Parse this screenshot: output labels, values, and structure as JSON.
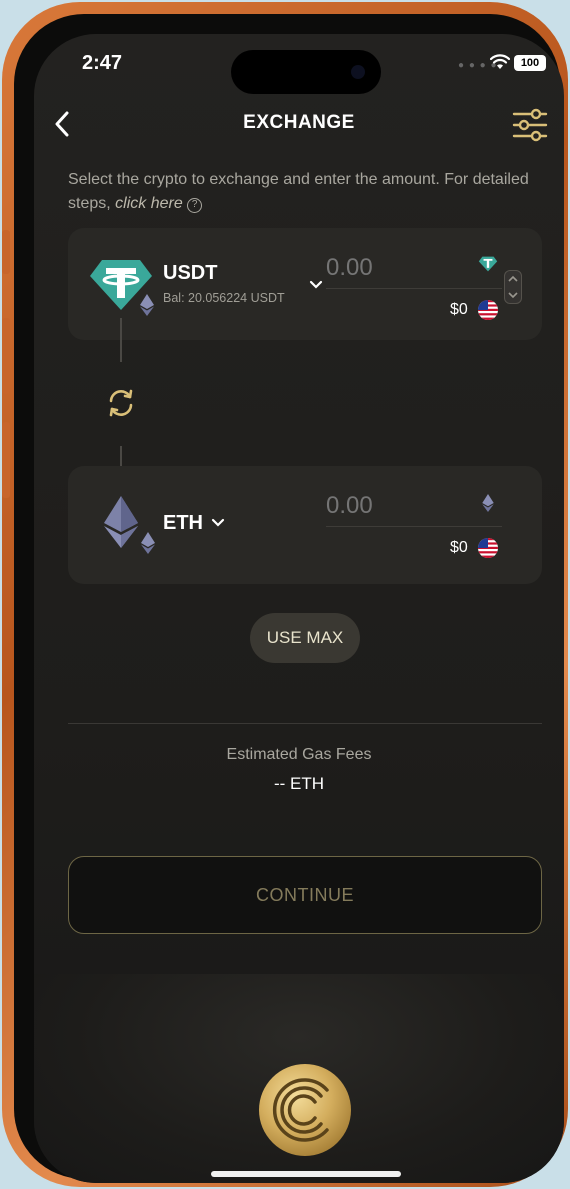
{
  "status_bar": {
    "time": "2:47",
    "signal_icon": "signal-dots-icon",
    "wifi_icon": "wifi-icon",
    "battery_level": "100"
  },
  "header": {
    "back_icon": "chevron-left-icon",
    "title": "EXCHANGE",
    "settings_icon": "sliders-icon"
  },
  "intro": {
    "text": "Select the crypto to exchange and enter the amount. For detailed steps,",
    "link_text": "click here",
    "help_icon": "question-circle-icon",
    "help_glyph": "?"
  },
  "from_token": {
    "symbol": "USDT",
    "balance": "Bal: 20.056224 USDT",
    "amount_placeholder": "0.00",
    "usd_value": "$0",
    "logo_icon": "tether-icon",
    "network_icon": "ethereum-network-icon",
    "flag_icon": "us-flag-icon"
  },
  "swap": {
    "icon": "swap-arrows-icon"
  },
  "to_token": {
    "symbol": "ETH",
    "amount_placeholder": "0.00",
    "usd_value": "$0",
    "logo_icon": "ethereum-icon",
    "network_icon": "ethereum-network-icon",
    "flag_icon": "us-flag-icon"
  },
  "use_max_label": "USE MAX",
  "gas": {
    "label": "Estimated Gas Fees",
    "value": "-- ETH"
  },
  "continue_label": "CONTINUE",
  "app_logo_icon": "gold-coin-logo-icon",
  "colors": {
    "background": "#1f1e1c",
    "card": "#292825",
    "gold_accent": "#c9a85c",
    "tether_teal": "#3aa89a",
    "frame_orange": "#d4763a"
  }
}
